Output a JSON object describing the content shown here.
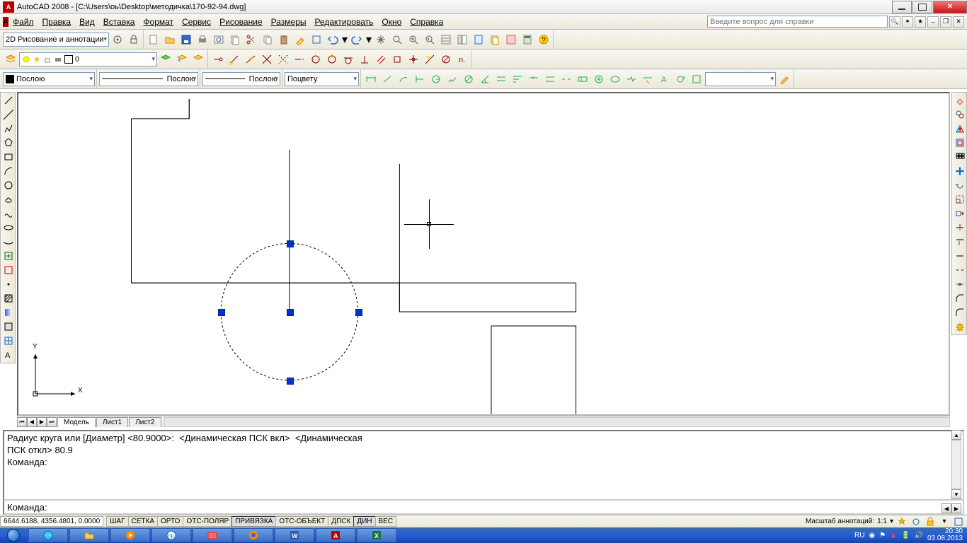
{
  "window": {
    "title": "AutoCAD 2008 - [C:\\Users\\оь\\Desktop\\методичка\\170-92-94.dwg]"
  },
  "menu": {
    "items": [
      "Файл",
      "Правка",
      "Вид",
      "Вставка",
      "Формат",
      "Сервис",
      "Рисование",
      "Размеры",
      "Редактировать",
      "Окно",
      "Справка"
    ],
    "help_placeholder": "Введите вопрос для справки"
  },
  "workspace": {
    "combo": "2D Рисование и аннотации"
  },
  "layer": {
    "current": "0"
  },
  "props": {
    "color": "Послою",
    "linetype": "Послою",
    "lineweight": "Послою",
    "plotstyle": "Поцвету"
  },
  "tabs": {
    "model": "Модель",
    "layout1": "Лист1",
    "layout2": "Лист2"
  },
  "command": {
    "history_line1": "Радиус круга или [Диаметр] <80.9000>:  <Динамическая ПСК вкл>  <Динамическая",
    "history_line2": "ПСК откл> 80.9",
    "history_line3": "Команда:",
    "prompt": "Команда:"
  },
  "status": {
    "coords": "6644.6188, 4356.4801, 0.0000",
    "toggles": [
      "ШАГ",
      "СЕТКА",
      "ОРТО",
      "ОТС-ПОЛЯР",
      "ПРИВЯЗКА",
      "ОТС-ОБЪЕКТ",
      "ДПСК",
      "ДИН",
      "ВЕС"
    ],
    "active_toggles": [
      "ПРИВЯЗКА",
      "ДИН"
    ],
    "anno_label": "Масштаб аннотаций:",
    "anno_scale": "1:1"
  },
  "taskbar": {
    "lang": "RU",
    "time": "20:30",
    "date": "03.08.2013"
  },
  "ucs": {
    "x": "X",
    "y": "Y"
  }
}
